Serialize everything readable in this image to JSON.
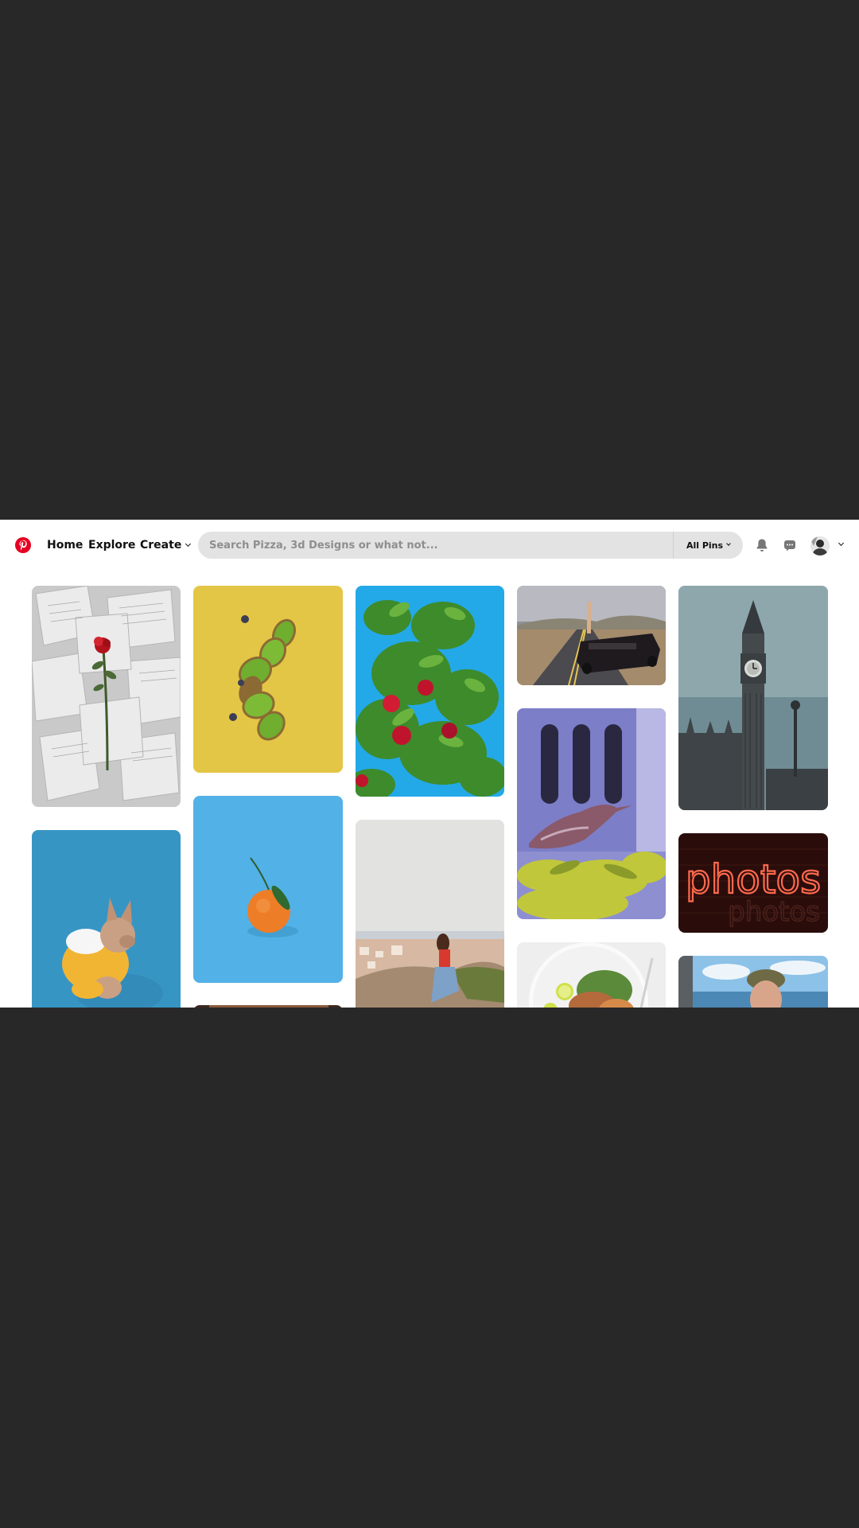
{
  "header": {
    "nav": {
      "home": "Home",
      "explore": "Explore",
      "create": "Create"
    },
    "search": {
      "placeholder": "Search Pizza, 3d Designs or what not...",
      "filter_label": "All Pins"
    },
    "icons": {
      "logo": "pinterest-logo",
      "notifications": "bell-icon",
      "messages": "message-icon",
      "account_menu": "chevron-down-icon"
    }
  },
  "pins": [
    {
      "name": "red rose on open book pages"
    },
    {
      "name": "sliced kiwi on yellow background"
    },
    {
      "name": "apple tree against blue sky"
    },
    {
      "name": "woman standing in convertible car on desert road"
    },
    {
      "name": "big ben clock tower"
    },
    {
      "name": "french bulldog in yellow hoodie"
    },
    {
      "name": "tangerine on blue background"
    },
    {
      "name": "woman sitting on rock above town"
    },
    {
      "name": "heron perched on branch"
    },
    {
      "name": "red neon photos sign",
      "text": "photos"
    },
    {
      "name": "salad plate with lime"
    },
    {
      "name": "man in cap by the sea"
    }
  ],
  "colors": {
    "brand": "#e60023",
    "background": "#282828",
    "surface": "#ffffff",
    "search_field": "#e3e3e3"
  }
}
